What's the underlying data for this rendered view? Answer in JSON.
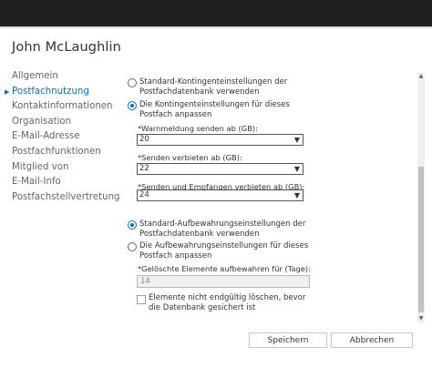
{
  "user": {
    "name": "John McLaughlin"
  },
  "nav": {
    "items": [
      {
        "label": "Allgemein",
        "active": false
      },
      {
        "label": "Postfachnutzung",
        "active": true
      },
      {
        "label": "Kontaktinformationen",
        "active": false
      },
      {
        "label": "Organisation",
        "active": false
      },
      {
        "label": "E-Mail-Adresse",
        "active": false
      },
      {
        "label": "Postfachfunktionen",
        "active": false
      },
      {
        "label": "Mitglied von",
        "active": false
      },
      {
        "label": "E-Mail-Info",
        "active": false
      },
      {
        "label": "Postfachstellvertretung",
        "active": false
      }
    ]
  },
  "quota": {
    "option_default": "Standard-Kontingenteinstellungen der Postfachdatenbank verwenden",
    "option_custom": "Die Kontingenteinstellungen für dieses Postfach anpassen",
    "selected": "custom",
    "warning_label": "*Warnmeldung senden ab (GB):",
    "warning_value": "20",
    "prohibit_send_label": "*Senden verbieten ab (GB):",
    "prohibit_send_value": "22",
    "prohibit_send_receive_label": "*Senden und Empfangen verbieten ab (GB):",
    "prohibit_send_receive_value": "24"
  },
  "retention": {
    "option_default": "Standard-Aufbewahrungseinstellungen der Postfachdatenbank verwenden",
    "option_custom": "Die Aufbewahrungseinstellungen für dieses Postfach anpassen",
    "selected": "default",
    "deleted_items_label": "*Gelöschte Elemente aufbewahren für (Tage):",
    "deleted_items_value": "14",
    "checkbox_label": "Elemente nicht endgültig löschen, bevor die Datenbank gesichert ist",
    "checkbox_checked": false
  },
  "buttons": {
    "save": "Speichern",
    "cancel": "Abbrechen"
  },
  "colors": {
    "accent": "#0072c6",
    "titlebar": "#1f1f1f"
  }
}
